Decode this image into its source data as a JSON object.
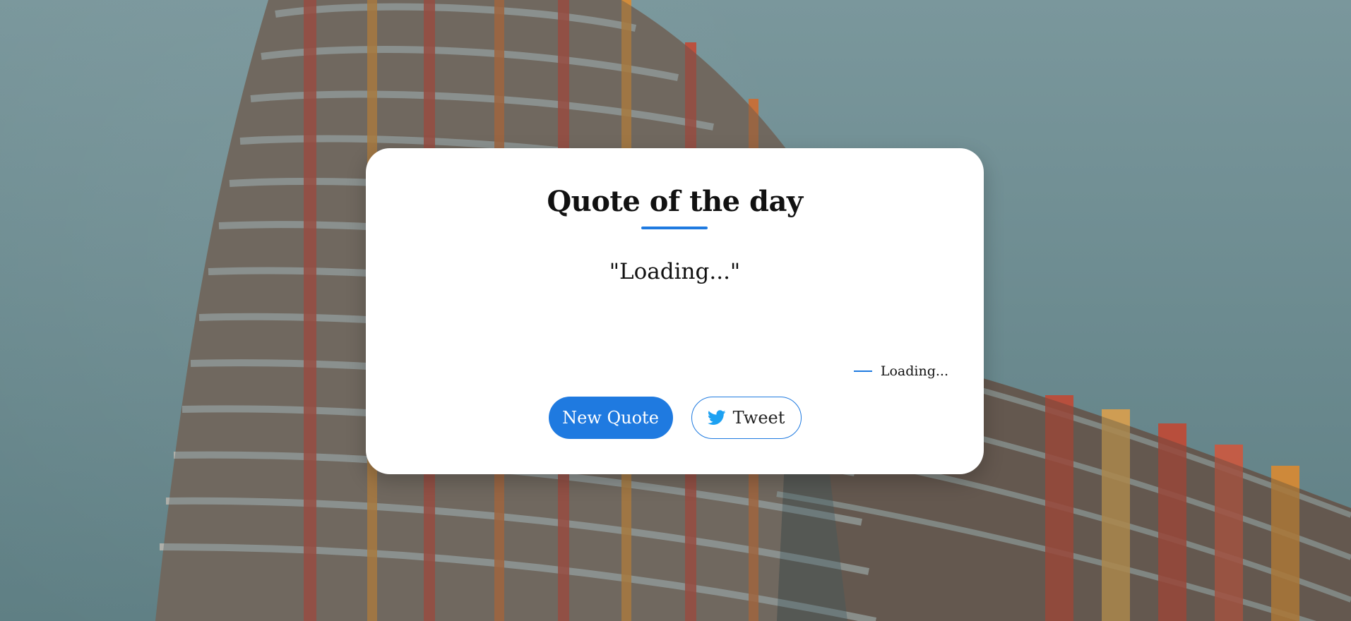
{
  "card": {
    "title": "Quote of the day",
    "quote": "\"Loading...\"",
    "author": "Loading..."
  },
  "buttons": {
    "new_quote": "New Quote",
    "tweet": "Tweet"
  },
  "icons": {
    "tweet": "twitter-icon"
  },
  "colors": {
    "accent": "#1f7ae0",
    "card_bg": "#ffffff",
    "twitter_blue": "#1da1f2"
  }
}
